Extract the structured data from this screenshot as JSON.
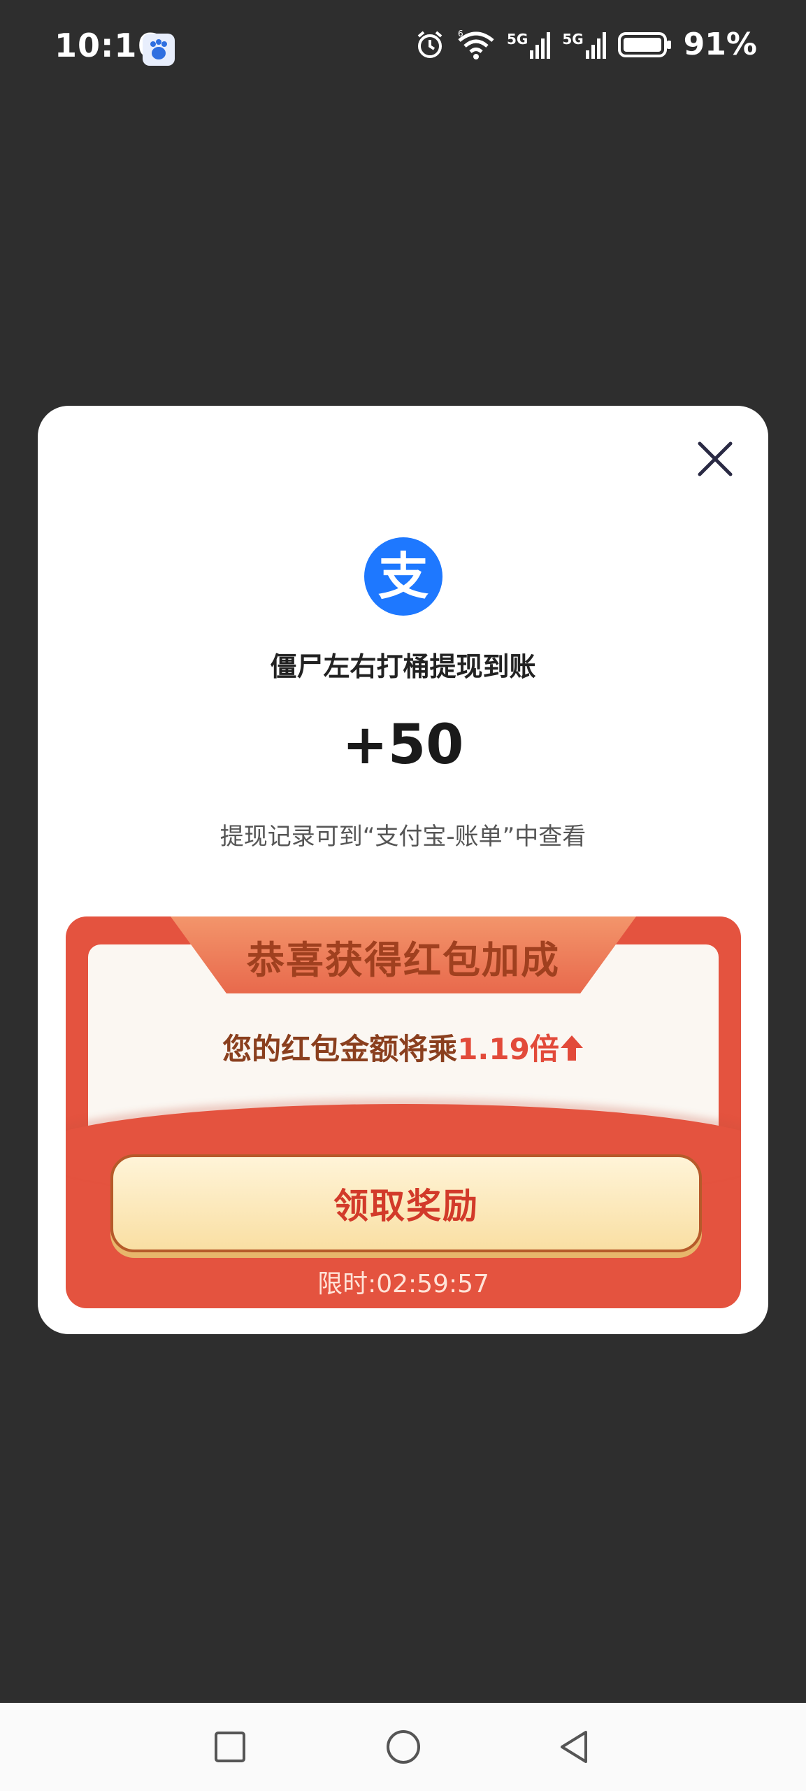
{
  "status_bar": {
    "time": "10:16",
    "network_1": "5G",
    "network_2": "5G",
    "wifi_badge": "6",
    "battery": "91%"
  },
  "dialog": {
    "title": "僵尸左右打桶提现到账",
    "amount": "+50",
    "note": "提现记录可到“支付宝-账单”中查看",
    "logo_text": "支"
  },
  "red_packet": {
    "banner": "恭喜获得红包加成",
    "desc_prefix": "您的红包金额将乘",
    "multiplier": "1.19倍",
    "claim_label": "领取奖励",
    "countdown": "限时:02:59:57"
  },
  "colors": {
    "alipay_blue": "#1e78ff",
    "red_packet": "#e4533f",
    "claim_text": "#d23a2a"
  },
  "icons": {
    "close": "close-icon",
    "nav_recent": "square-icon",
    "nav_home": "circle-icon",
    "nav_back": "triangle-back-icon"
  }
}
